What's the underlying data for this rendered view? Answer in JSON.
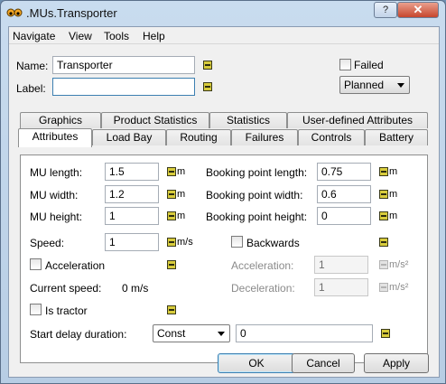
{
  "window": {
    "title": ".MUs.Transporter",
    "help_glyph": "?",
    "close_glyph": "✕"
  },
  "menu": [
    "Navigate",
    "View",
    "Tools",
    "Help"
  ],
  "header": {
    "name_label": "Name:",
    "name_value": "Transporter",
    "label_label": "Label:",
    "label_value": "",
    "failed_label": "Failed",
    "status_select": "Planned"
  },
  "tabs_row1": [
    "Graphics",
    "Product Statistics",
    "Statistics",
    "User-defined Attributes"
  ],
  "tabs_row2": [
    "Attributes",
    "Load Bay",
    "Routing",
    "Failures",
    "Controls",
    "Battery"
  ],
  "attributes": {
    "mu_length_label": "MU length:",
    "mu_length": "1.5",
    "mu_width_label": "MU width:",
    "mu_width": "1.2",
    "mu_height_label": "MU height:",
    "mu_height": "1",
    "bp_length_label": "Booking point length:",
    "bp_length": "0.75",
    "bp_width_label": "Booking point width:",
    "bp_width": "0.6",
    "bp_height_label": "Booking point height:",
    "bp_height": "0",
    "unit_m": "m",
    "speed_label": "Speed:",
    "speed": "1",
    "speed_unit": "m/s",
    "backwards_label": "Backwards",
    "acceleration_check_label": "Acceleration",
    "acceleration_label": "Acceleration:",
    "acceleration": "1",
    "deceleration_label": "Deceleration:",
    "deceleration": "1",
    "accel_unit": "m/s²",
    "current_speed_label": "Current speed:",
    "current_speed": "0 m/s",
    "is_tractor_label": "Is tractor",
    "start_delay_label": "Start delay duration:",
    "start_delay_type": "Const",
    "start_delay_value": "0"
  },
  "buttons": {
    "ok": "OK",
    "cancel": "Cancel",
    "apply": "Apply"
  },
  "colors": {
    "frame": "#b7cde4",
    "face": "#f0f0f0",
    "accent": "#3c7fb1",
    "attr_icon": "#d8cc3c"
  }
}
